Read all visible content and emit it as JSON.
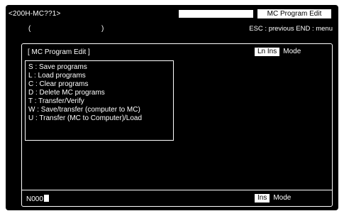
{
  "header": {
    "device": "<200H-MC??1>",
    "paren_open": "(",
    "paren_close": ")",
    "title": "MC Program Edit",
    "hint": "ESC : previous END : menu"
  },
  "panel": {
    "title": "[ MC Program Edit   ]",
    "top_mode_badge": "Ln Ins",
    "top_mode_label": "Mode",
    "menu": [
      "S : Save programs",
      "L : Load programs",
      "C : Clear programs",
      "D : Delete MC programs",
      "T : Transfer/Verify",
      "W : Save/transfer (computer to MC)",
      "U : Transfer (MC to Computer)/Load"
    ],
    "line_number": "N000",
    "bottom_mode_badge": "Ins",
    "bottom_mode_label": "Mode"
  }
}
